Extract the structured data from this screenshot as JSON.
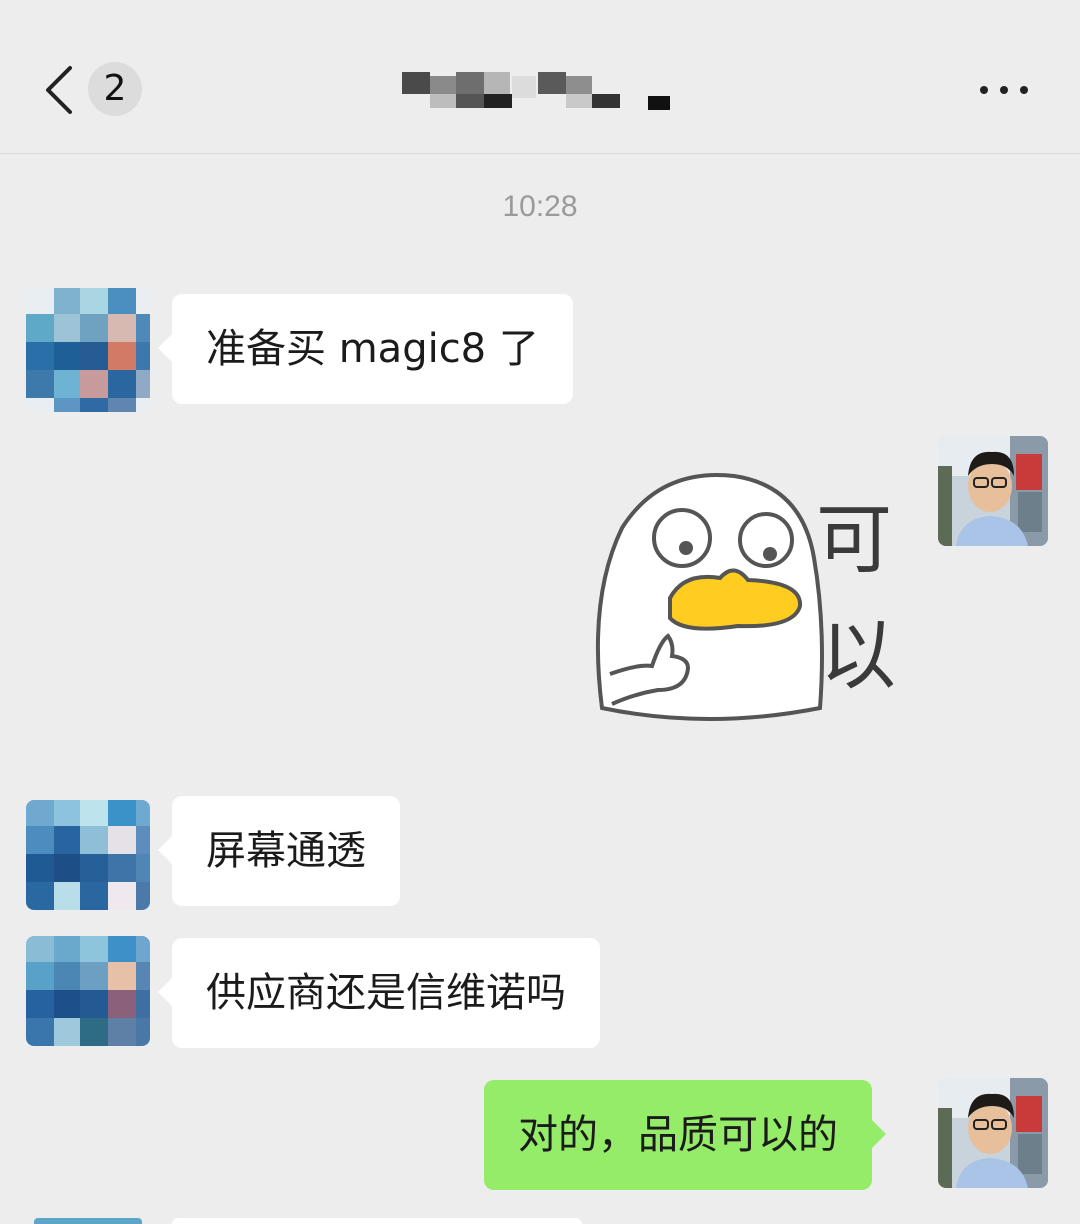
{
  "header": {
    "unread_count": "2",
    "title": "",
    "back_icon": "chevron-left-icon",
    "more_icon": "more-dots-icon"
  },
  "chat": {
    "timestamp": "10:28",
    "messages": [
      {
        "side": "incoming",
        "text": "准备买 magic8 了"
      },
      {
        "side": "outgoing",
        "type": "sticker",
        "text": "可以"
      },
      {
        "side": "incoming",
        "text": "屏幕通透"
      },
      {
        "side": "incoming",
        "text": "供应商还是信维诺吗"
      },
      {
        "side": "outgoing",
        "text": "对的，品质可以的"
      }
    ]
  },
  "colors": {
    "background": "#ededed",
    "incoming_bubble": "#ffffff",
    "outgoing_bubble": "#95ec69",
    "timestamp": "#9a9a9a"
  }
}
